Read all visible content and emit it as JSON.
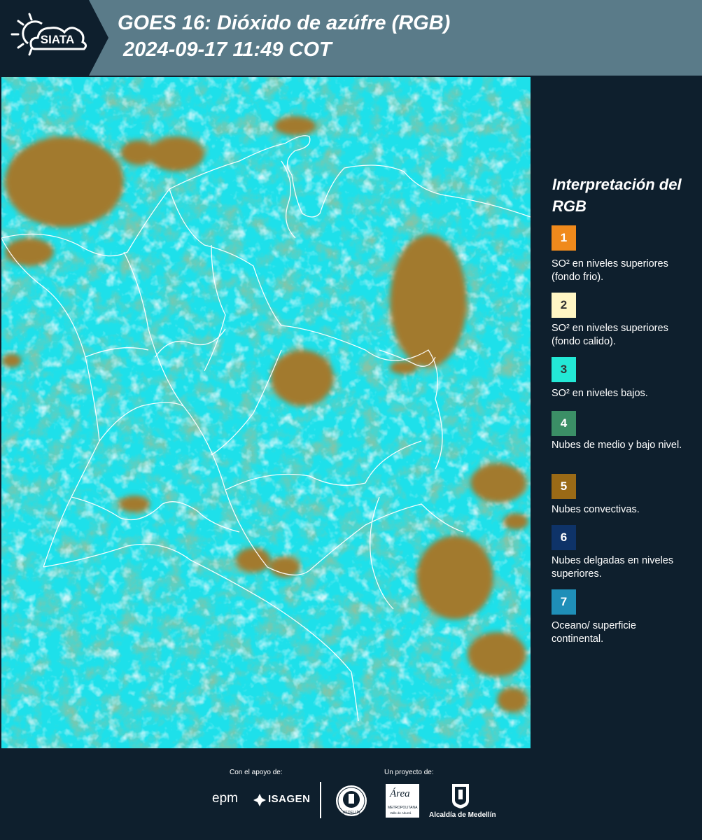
{
  "header": {
    "logo_text": "SIATA",
    "title": "GOES 16: Dióxido de azúfre (RGB)\n 2024-09-17 11:49 COT"
  },
  "legend": {
    "title": "Interpretación del RGB",
    "items": [
      {
        "num": "1",
        "color": "#f08a1c",
        "text": "SO² en niveles superiores (fondo frio)."
      },
      {
        "num": "2",
        "color": "#fff6c4",
        "text": "SO² en niveles superiores (fondo calido)."
      },
      {
        "num": "3",
        "color": "#23e8d6",
        "text": "SO² en niveles bajos."
      },
      {
        "num": "4",
        "color": "#3b8f66",
        "text": "Nubes de medio y bajo nivel."
      },
      {
        "num": "5",
        "color": "#9a6a16",
        "text": "Nubes convectivas."
      },
      {
        "num": "6",
        "color": "#0e3368",
        "text": "Nubes delgadas en niveles superiores."
      },
      {
        "num": "7",
        "color": "#1f8fb8",
        "text": "Oceano/ superficie continental."
      }
    ]
  },
  "footer": {
    "support_label": "Con el apoyo de:",
    "project_label": "Un proyecto de:",
    "epm": "epm",
    "isagen": "ISAGEN",
    "area_word": "Área",
    "area_sub": "METROPOLITANA",
    "area_sub2": "Valle de Aburrá",
    "alcaldia": "Alcaldía de Medellín",
    "seal_text": "MEDELLÍN"
  },
  "colors": {
    "background": "#0e1f2d",
    "header": "#5a7b89",
    "ocean": "#1ee0ea",
    "cloud_low": "#3f8f63",
    "cloud_convective": "#a27a2e"
  }
}
